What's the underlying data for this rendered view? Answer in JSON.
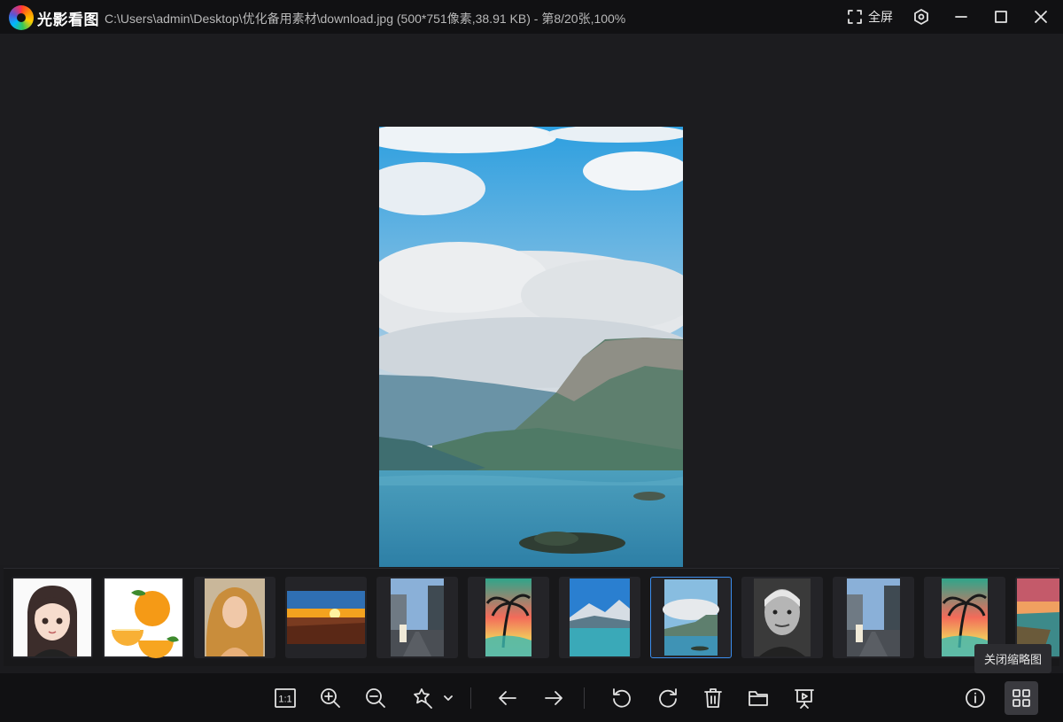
{
  "app": {
    "name": "光影看图",
    "file_path": "C:\\Users\\admin\\Desktop\\优化备用素材\\download.jpg (500*751像素,38.91 KB) - 第8/20张,100%"
  },
  "titlebar": {
    "fullscreen_label": "全屏"
  },
  "viewer": {
    "image_name": "download.jpg"
  },
  "thumbnails": [
    {
      "subject": "cartoon-girl",
      "selected": false
    },
    {
      "subject": "oranges",
      "selected": false
    },
    {
      "subject": "blonde-woman",
      "selected": false
    },
    {
      "subject": "sunset-field",
      "selected": false
    },
    {
      "subject": "street-scene",
      "selected": false
    },
    {
      "subject": "palm-beach-sunset",
      "selected": false
    },
    {
      "subject": "lake-mountains",
      "selected": false
    },
    {
      "subject": "lake-mountains-selected",
      "selected": true
    },
    {
      "subject": "old-man-portrait",
      "selected": false
    },
    {
      "subject": "street-scene",
      "selected": false
    },
    {
      "subject": "palm-beach-sunset",
      "selected": false
    },
    {
      "subject": "coast-sunset",
      "selected": false
    }
  ],
  "tooltip": "关闭缩略图",
  "toolbar": {
    "actual_size_label": "1:1",
    "icons": [
      "actual-size-icon",
      "zoom-in-icon",
      "zoom-out-icon",
      "magic-enhance-icon",
      "chevron-down-icon",
      "previous-arrow-icon",
      "next-arrow-icon",
      "rotate-left-icon",
      "rotate-right-icon",
      "delete-icon",
      "folder-icon",
      "slideshow-icon",
      "info-icon",
      "grid-icon"
    ]
  },
  "colors": {
    "background": "#1b1b1e",
    "titlebar": "#111113",
    "selected_border": "#3b8ded"
  }
}
